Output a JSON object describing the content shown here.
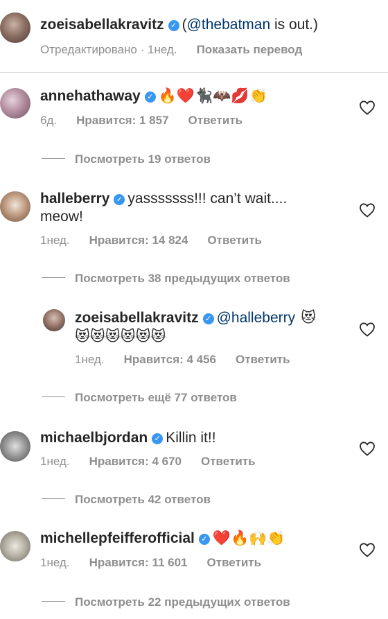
{
  "caption": {
    "user": "zoeisabellakravitz",
    "text_prefix": "(",
    "mention": "@thebatman",
    "text_suffix": " is out.)",
    "meta_time": "Отредактировано · 1нед.",
    "meta_translate": "Показать перевод"
  },
  "comments": [
    {
      "user": "annehathaway",
      "text": "🔥❤️🐈‍⬛🦇💋👏",
      "time": "6д.",
      "likes": "Нравится: 1 857",
      "reply": "Ответить",
      "view_replies": "Посмотреть 19 ответов"
    },
    {
      "user": "halleberry",
      "text_line1": "yasssssss!!! can’t wait....",
      "text_line2": "meow!",
      "time": "1нед.",
      "likes": "Нравится: 14 824",
      "reply": "Ответить",
      "view_replies": "Посмотреть 38 предыдущих ответов",
      "nested_reply": {
        "user": "zoeisabellakravitz",
        "mention": "@halleberry",
        "emoji_inline": "😻",
        "emoji_line2": "😻😻😻😻😻😻",
        "time": "1нед.",
        "likes": "Нравится: 4 456",
        "reply": "Ответить",
        "view_replies": "Посмотреть ещё 77 ответов"
      }
    },
    {
      "user": "michaelbjordan",
      "text": "Killin it!!",
      "time": "1нед.",
      "likes": "Нравится: 4 670",
      "reply": "Ответить",
      "view_replies": "Посмотреть 42 ответов"
    },
    {
      "user": "michellepfeifferofficial",
      "text": "❤️🔥🙌👏",
      "time": "1нед.",
      "likes": "Нравится: 11 601",
      "reply": "Ответить",
      "view_replies": "Посмотреть 22 предыдущих ответов"
    }
  ],
  "icons": {
    "verified": "✓",
    "heart": "heart-outline-icon"
  },
  "colors": {
    "verified_badge": "#3897f0",
    "mention": "#00376b",
    "meta": "#8e8e8e",
    "text": "#262626"
  }
}
